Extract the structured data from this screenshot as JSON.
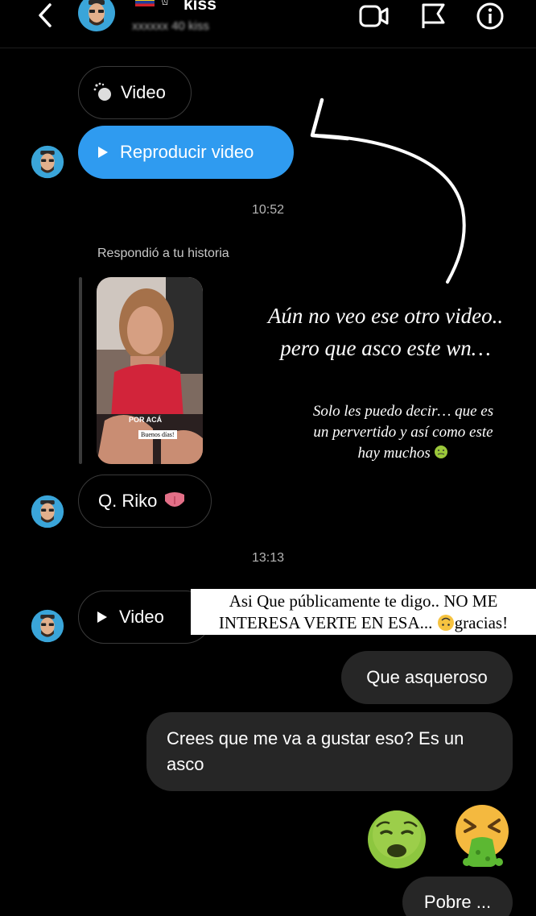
{
  "header": {
    "name": "kiss",
    "subtitle": "xxxxxx 40 kiss",
    "hand_emoji": "✌"
  },
  "messages": {
    "video_label_1": "Video",
    "play_video_label": "Reproducir video",
    "time_1": "10:52",
    "story_reply_label": "Respondió a tu historia",
    "story_caption_title": "POR ACÁ",
    "story_caption_sub": "Buenos días!",
    "q_riko_text": "Q. Riko",
    "time_2": "13:13",
    "video_label_2": "Video",
    "que_asqueroso": "Que asqueroso",
    "crees_line1": "Crees que me va a gustar eso? Es un",
    "crees_line2": "asco",
    "pobre": "Pobre ..."
  },
  "overlay": {
    "line1": "Aún no veo ese otro video..",
    "line2": "pero que asco este wn…",
    "small_line1": "Solo les puedo decir… que es",
    "small_line2": "un pervertido y así como este",
    "small_line3": "hay muchos",
    "caption_line1": "Asi Que públicamente te digo.. NO ME",
    "caption_line2a": "INTERESA VERTE EN ESA...",
    "caption_line2b": "gracias!"
  },
  "icons": [
    "chevron-left-icon",
    "video-call-icon",
    "flag-icon",
    "info-icon",
    "emoji-nauseated-face",
    "emoji-vomiting-face",
    "emoji-upside-down-face",
    "emoji-tongue"
  ]
}
